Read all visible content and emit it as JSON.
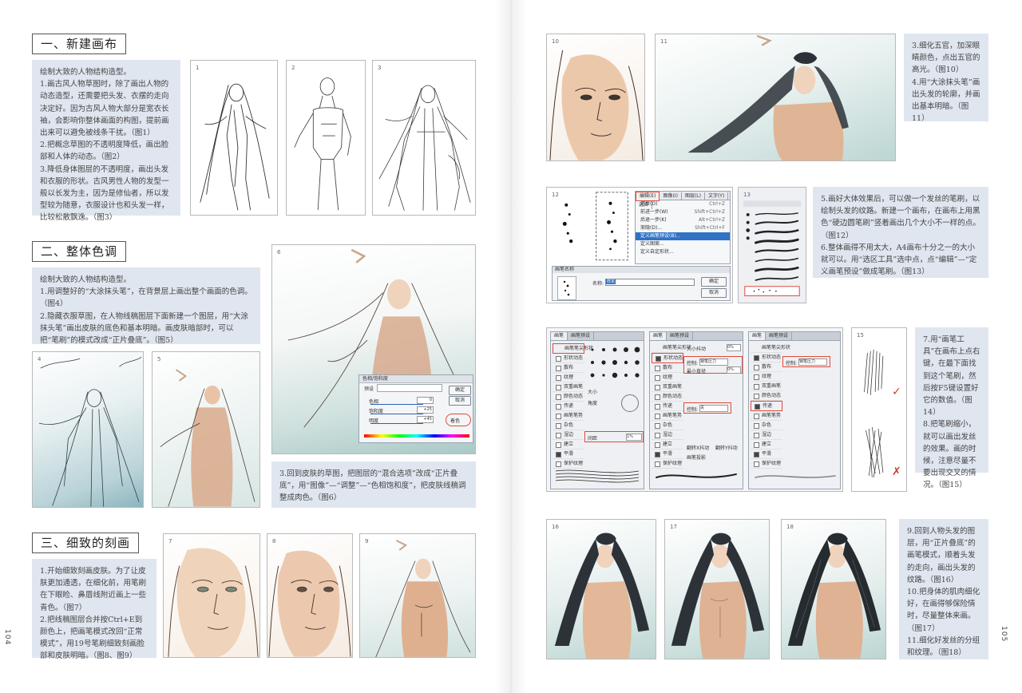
{
  "sections": {
    "s1": "一、新建画布",
    "s2": "二、整体色调",
    "s3": "三、细致的刻画"
  },
  "text_blocks": {
    "t1": [
      "绘制大致的人物结构造型。",
      "1.画古风人物草图时，除了画出人物的动态造型，还需要把头发、衣摆的走向决定好。因为古风人物大部分是宽衣长袖，会影响你整体画面的构图，提前画出来可以避免被线条干扰。（图1）",
      "2.把概念草图的不透明度降低，画出脸部和人体的动态。（图2）",
      "3.降低身体图层的不透明度，画出头发和衣服的形状。古风男性人物的发型一般以长发为主，因为是修仙者，所以发型较为随意，衣服设计也和头发一样，比较松散飘逸。（图3）"
    ],
    "t2": [
      "绘制大致的人物结构造型。",
      "1.用调整好的“大涂抹头笔”，在背景层上画出整个画面的色调。（图4）",
      "2.隐藏衣服草图，在人物线稿图层下面新建一个图层，用“大涂抹头笔”画出皮肤的底色和基本明暗。画皮肤暗部时，可以把“笔刷”的模式改成“正片叠底”。（图5）"
    ],
    "t3": [
      "3.回到皮肤的草图，把图层的“混合选项”改成“正片叠底”，用“图像”—“调整”—“色相饱和度”，把皮肤线稿调整成肉色。（图6）"
    ],
    "t4": [
      "1.开始细致刻画皮肤。为了让皮肤更加通透，在细化前，用笔刷在下眼睑、鼻唇线附近画上一些青色。（图7）",
      "2.把线稿图层合并按Ctrl+E到颜色上，把画笔模式改回“正常模式”，用19号笔刷细致刻画脸部和皮肤明暗。（图8、图9）"
    ],
    "t5": [
      "3.细化五官，加深眼睛颜色，点出五官的高光。（图10）",
      "4.用“大涂抹头笔”画出头发的轮廓，并画出基本明暗。（图11）"
    ],
    "t6": [
      "5.画好大体效果后，可以做一个发丝的笔刷，以绘制头发的纹路。新建一个画布，在画布上用黑色“硬边圆笔刷”竖着画出几个大小不一样的点。（图12）",
      "6.整体画得不用太大，A4画布十分之一的大小就可以。用“选区工具”选中点，点“编辑”—“定义画笔预设”做成笔刷。（图13）"
    ],
    "t7": [
      "7.用“画笔工具”在画布上点右键，在最下面找到这个笔刷，然后按F5键设置好它的数值。（图14）",
      "8.把笔刷缩小，就可以画出发丝的效果。画的时候，注意尽量不要出现交叉的情况。（图15）"
    ],
    "t8": [
      "9.回到人物头发的图层，用“正片叠底”的画笔模式，顺着头发的走向，画出头发的纹路。（图16）",
      "10.把身体的肌肉细化好，在画得够保险情时，尽量整体来画。（图17）",
      "11.细化好发丝的分组和纹理。（图18）"
    ]
  },
  "figures": {
    "f1": "1",
    "f2": "2",
    "f3": "3",
    "f4": "4",
    "f5": "5",
    "f6": "6",
    "f7": "7",
    "f8": "8",
    "f9": "9",
    "f10": "10",
    "f11": "11",
    "f12": "12",
    "f13": "13",
    "f15": "15",
    "f16": "16",
    "f17": "17",
    "f18": "18"
  },
  "ps_edit_menu": {
    "tabs": [
      "编辑(E)",
      "图像(I)",
      "图层(L)",
      "文字(Y)",
      "选择"
    ],
    "items": [
      {
        "label": "还原(O)",
        "shortcut": "Ctrl+Z"
      },
      {
        "label": "前进一步(W)",
        "shortcut": "Shift+Ctrl+Z"
      },
      {
        "label": "后退一步(K)",
        "shortcut": "Alt+Ctrl+Z"
      },
      {
        "label": "渐隐(D)...",
        "shortcut": "Shift+Ctrl+F"
      },
      {
        "label": "定义画笔预设(B)...",
        "shortcut": ""
      },
      {
        "label": "定义图案...",
        "shortcut": ""
      },
      {
        "label": "定义自定形状...",
        "shortcut": ""
      }
    ],
    "dialog_title": "画笔名称",
    "name_label": "名称:",
    "name_value": "样本",
    "ok": "确定",
    "cancel": "取消"
  },
  "ps_brush_panel": {
    "tabs": [
      "画笔",
      "画笔预设"
    ],
    "items": [
      "画笔笔尖形状",
      "形状动态",
      "散布",
      "纹理",
      "双重画笔",
      "颜色动态",
      "传递",
      "画笔笔势",
      "杂色",
      "湿边",
      "建立",
      "平滑",
      "保护纹理"
    ],
    "size_label": "大小",
    "angle_label": "角度",
    "spacing_label": "间距",
    "spacing_value": "1%",
    "control_label": "控制:",
    "control_value": "钢笔压力",
    "control_value2": "关",
    "min_label": "最小直径",
    "min_value": "0%",
    "jitter_label": "大小抖动",
    "jitter_value": "0%",
    "flip_x": "翻转X抖动",
    "flip_y": "翻转Y抖动",
    "brush_proj": "画笔投影"
  },
  "hue_dialog": {
    "title": "色相/饱和度",
    "preset": "预设",
    "hue": "色相",
    "sat": "饱和度",
    "light": "明度",
    "hue_value": "0",
    "sat_value": "+25",
    "light_value": "+45",
    "ok": "确定",
    "cancel": "取消",
    "colorize": "着色"
  },
  "page_numbers": {
    "left": "104",
    "right": "105"
  },
  "colors": {
    "text_bg": "#dfe6ef",
    "accent_red": "#e04b3a",
    "check_red": "#d43a2c"
  }
}
